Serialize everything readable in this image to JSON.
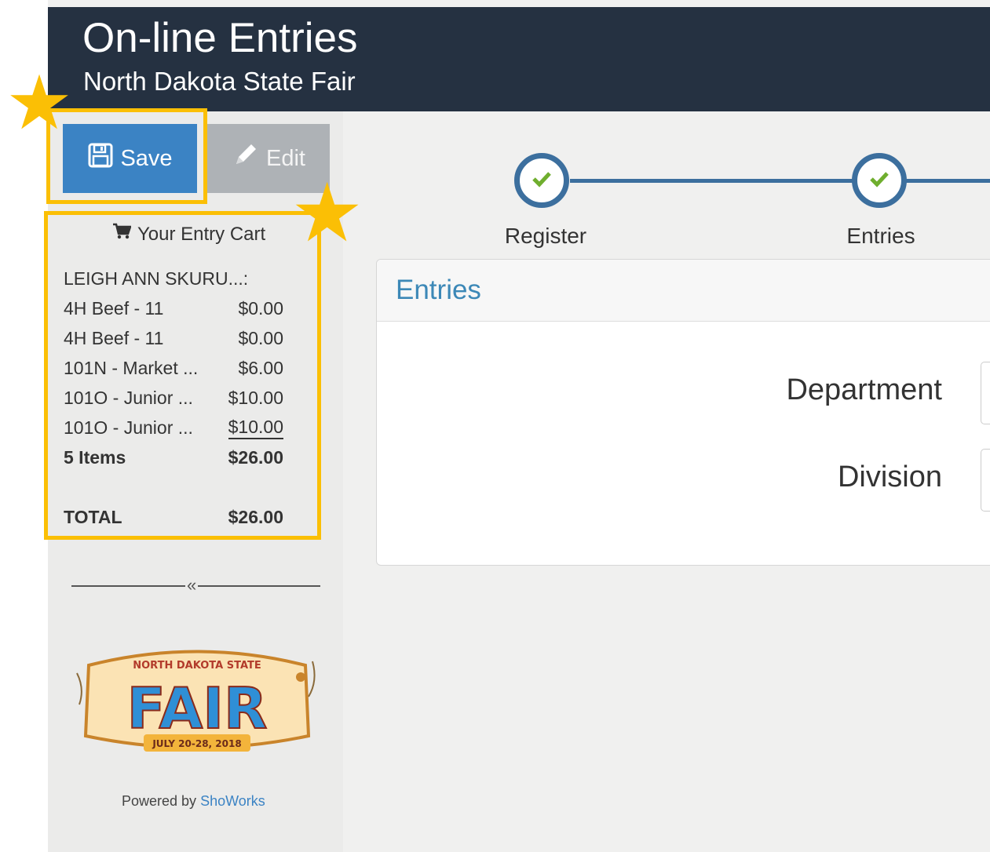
{
  "header": {
    "title": "On-line Entries",
    "subtitle": "North Dakota State Fair"
  },
  "toolbar": {
    "save_label": "Save",
    "edit_label": "Edit"
  },
  "cart": {
    "header": "Your Entry Cart",
    "owner": "LEIGH ANN SKURU...:",
    "items": [
      {
        "name": "4H Beef - 11",
        "price": "$0.00"
      },
      {
        "name": "4H Beef - 11",
        "price": "$0.00"
      },
      {
        "name": "101N - Market ...",
        "price": "$6.00"
      },
      {
        "name": "101O - Junior ...",
        "price": "$10.00"
      },
      {
        "name": "101O - Junior ...",
        "price": "$10.00"
      }
    ],
    "subtotal_label": "5 Items",
    "subtotal_value": "$26.00",
    "total_label": "TOTAL",
    "total_value": "$26.00"
  },
  "steps": [
    {
      "label": "Register",
      "complete": true
    },
    {
      "label": "Entries",
      "complete": true
    }
  ],
  "panel": {
    "title": "Entries",
    "fields": [
      {
        "label": "Department"
      },
      {
        "label": "Division"
      }
    ]
  },
  "footer": {
    "powered_prefix": "Powered by",
    "powered_link": "ShoWorks"
  },
  "logo": {
    "top_text": "NORTH DAKOTA STATE",
    "main_text": "FAIR",
    "date_text": "JULY 20-28, 2018"
  },
  "colors": {
    "header_bg": "#253141",
    "accent_blue": "#3b83c4",
    "highlight_yellow": "#fbbf05",
    "step_blue": "#3c6f9e",
    "check_green": "#6fae2e"
  }
}
